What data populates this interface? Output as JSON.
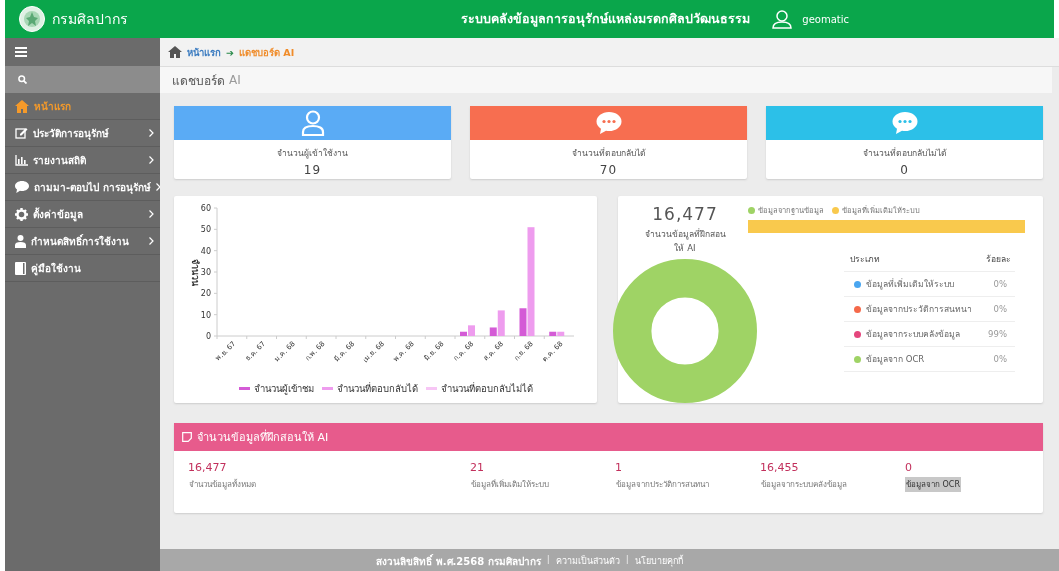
{
  "header": {
    "brand": "กรมศิลปากร",
    "title": "ระบบคลังข้อมูลการอนุรักษ์แหล่งมรดกศิลปวัฒนธรรม",
    "user": "geomatic"
  },
  "sidebar": {
    "items": [
      {
        "label": "หน้าแรก",
        "kind": "home",
        "selected": true,
        "submenu": false
      },
      {
        "label": "ประวัติการอนุรักษ์",
        "kind": "edit",
        "selected": false,
        "submenu": true
      },
      {
        "label": "รายงานสถิติ",
        "kind": "chart",
        "selected": false,
        "submenu": true
      },
      {
        "label": "ถามมา-ตอบไป การอนุรักษ์",
        "kind": "chat",
        "selected": false,
        "submenu": true
      },
      {
        "label": "ตั้งค่าข้อมูล",
        "kind": "gear",
        "selected": false,
        "submenu": true
      },
      {
        "label": "กำหนดสิทธิ์การใช้งาน",
        "kind": "user",
        "selected": false,
        "submenu": true
      },
      {
        "label": "คู่มือใช้งาน",
        "kind": "book",
        "selected": false,
        "submenu": false
      }
    ]
  },
  "breadcrumb": {
    "home": "หน้าแรก",
    "arrow": "➔",
    "current": "แดชบอร์ด AI"
  },
  "page_title": {
    "main": "แดชบอร์ด",
    "suffix": "AI"
  },
  "stat_cards": [
    {
      "kind": "user",
      "color": "#5aabf5",
      "label": "จำนวนผู้เข้าใช้งาน",
      "value": "19"
    },
    {
      "kind": "chat",
      "color": "#f76e50",
      "label": "จำนวนที่ตอบกลับได้",
      "value": "70"
    },
    {
      "kind": "chat",
      "color": "#2cc0e8",
      "label": "จำนวนที่ตอบกลับไม่ได้",
      "value": "0"
    }
  ],
  "bar_chart": {
    "chart_data": {
      "type": "bar",
      "ylabel": "จำนวน",
      "categories": [
        "พ.ย. 67",
        "ธ.ค. 67",
        "ม.ค. 68",
        "ก.พ. 68",
        "มี.ค. 68",
        "เม.ย. 68",
        "พ.ค. 68",
        "มิ.ย. 68",
        "ก.ค. 68",
        "ส.ค. 68",
        "ก.ย. 68",
        "ต.ค. 68"
      ],
      "ylim": [
        0,
        60
      ],
      "yticks": [
        0,
        10,
        20,
        30,
        40,
        50,
        60
      ],
      "series": [
        {
          "name": "จำนวนผู้เข้าชม",
          "color": "#d45bd6",
          "values": [
            0,
            0,
            0,
            0,
            0,
            0,
            0,
            0,
            2,
            4,
            13,
            2
          ]
        },
        {
          "name": "จำนวนที่ตอบกลับได้",
          "color": "#ee9cee",
          "values": [
            0,
            0,
            0,
            0,
            0,
            0,
            0,
            0,
            5,
            12,
            51,
            2
          ]
        },
        {
          "name": "จำนวนที่ตอบกลับไม่ได้",
          "color": "#f7c6f5",
          "values": [
            0,
            0,
            0,
            0,
            0,
            0,
            0,
            0,
            0,
            0,
            0,
            0
          ]
        }
      ]
    }
  },
  "ai_summary": {
    "total": "16,477",
    "caption": "จำนวนข้อมูลที่ฝึกสอนให้ AI",
    "legend": [
      {
        "label": "ข้อมูลจากฐานข้อมูล",
        "color": "#9fd365"
      },
      {
        "label": "ข้อมูลที่เพิ่มเติมให้ระบบ",
        "color": "#f9c94d"
      }
    ],
    "bar": {
      "level": 1
    },
    "table": {
      "columns": [
        "ประเภท",
        "ร้อยละ"
      ],
      "rows": [
        {
          "label": "ข้อมูลที่เพิ่มเติมให้ระบบ",
          "color": "#4aa6f0",
          "percent": "0%"
        },
        {
          "label": "ข้อมูลจากประวัติการสนทนา",
          "color": "#f5694a",
          "percent": "0%"
        },
        {
          "label": "ข้อมูลจากระบบคลังข้อมูล",
          "color": "#e5467d",
          "percent": "99%"
        },
        {
          "label": "ข้อมูลจาก OCR",
          "color": "#9fd365",
          "percent": "0%"
        }
      ]
    }
  },
  "training_panel": {
    "title": "จำนวนข้อมูลที่ฝึกสอนให้ AI",
    "items": [
      {
        "value": "16,477",
        "label": "จำนวนข้อมูลทั้งหมด",
        "selected": false
      },
      {
        "value": "21",
        "label": "ข้อมูลที่เพิ่มเติมให้ระบบ",
        "selected": false
      },
      {
        "value": "1",
        "label": "ข้อมูลจากประวัติการสนทนา",
        "selected": false
      },
      {
        "value": "16,455",
        "label": "ข้อมูลจากระบบคลังข้อมูล",
        "selected": false
      },
      {
        "value": "0",
        "label": "ข้อมูลจาก OCR",
        "selected": true
      }
    ]
  },
  "footer": {
    "copyright": "สงวนลิขสิทธิ์ พ.ศ.2568 กรมศิลปากร",
    "separator": "|",
    "links": [
      "ความเป็นส่วนตัว",
      "นโยบายคุกกี้"
    ]
  }
}
